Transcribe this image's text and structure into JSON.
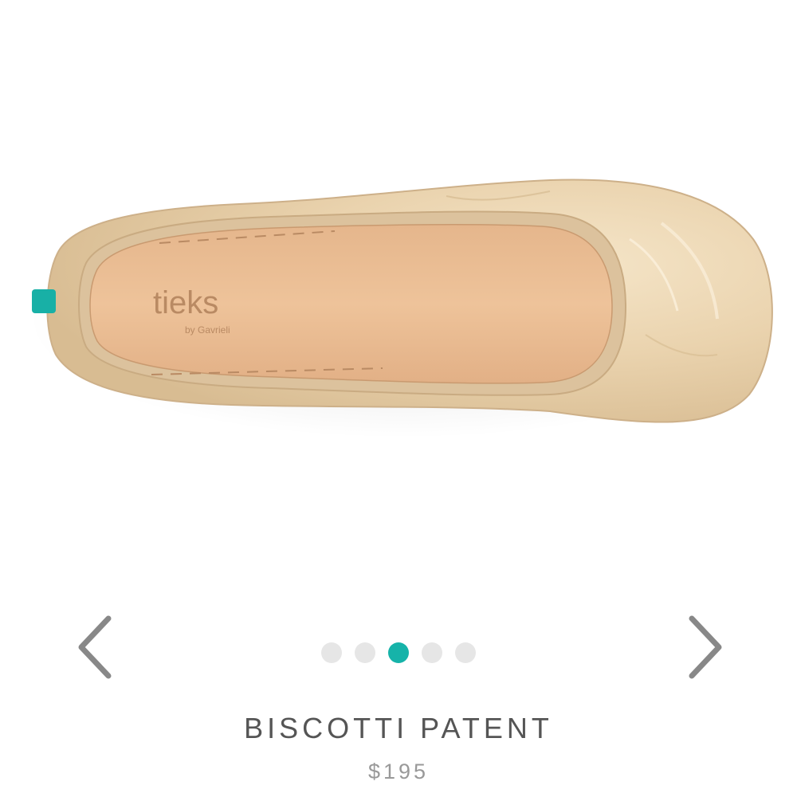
{
  "product": {
    "name": "BISCOTTI PATENT",
    "price": "$195",
    "image_alt": "Biscotti patent ballet flat, top view",
    "insole_brand": "tieks",
    "insole_subbrand": "by Gavrieli"
  },
  "carousel": {
    "slide_count": 5,
    "active_index": 2,
    "prev_icon": "chevron-left-icon",
    "next_icon": "chevron-right-icon"
  },
  "colors": {
    "accent": "#16b3a9",
    "dot_inactive": "#e6e6e6",
    "arrow": "#888888",
    "title": "#555555",
    "price": "#999999"
  }
}
